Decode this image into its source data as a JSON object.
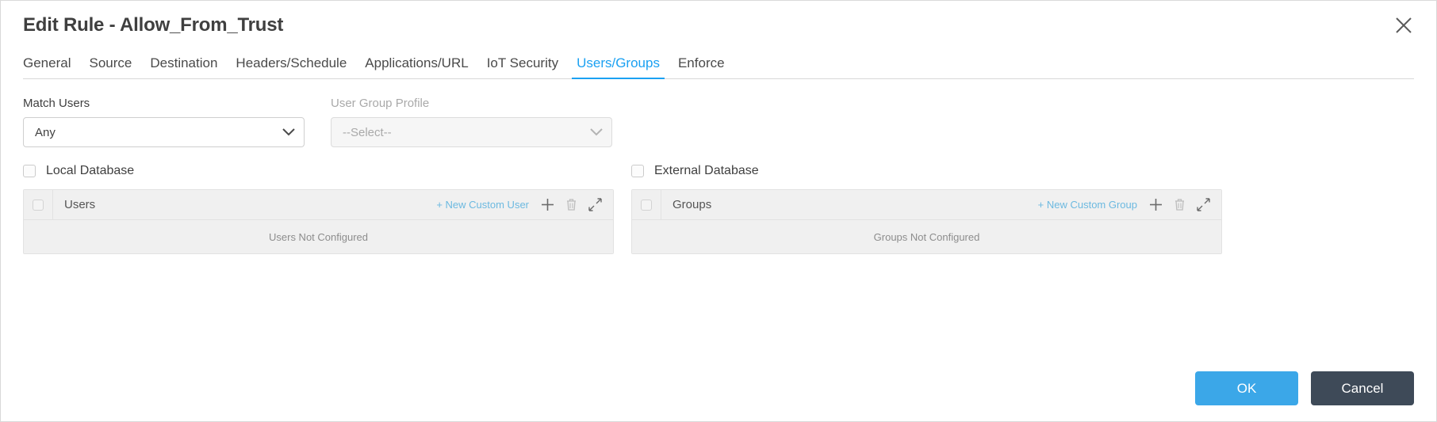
{
  "window": {
    "title": "Edit Rule - Allow_From_Trust",
    "close_icon": "close-icon"
  },
  "tabs": [
    {
      "label": "General",
      "active": false
    },
    {
      "label": "Source",
      "active": false
    },
    {
      "label": "Destination",
      "active": false
    },
    {
      "label": "Headers/Schedule",
      "active": false
    },
    {
      "label": "Applications/URL",
      "active": false
    },
    {
      "label": "IoT Security",
      "active": false
    },
    {
      "label": "Users/Groups",
      "active": true
    },
    {
      "label": "Enforce",
      "active": false
    }
  ],
  "form": {
    "match_users": {
      "label": "Match Users",
      "value": "Any",
      "disabled": false
    },
    "user_group_profile": {
      "label": "User Group Profile",
      "value": "--Select--",
      "disabled": true
    }
  },
  "panels": [
    {
      "checkbox_label": "Local Database",
      "checked": false,
      "table": {
        "column_header": "Users",
        "new_link": "+ New Custom User",
        "empty_message": "Users Not Configured",
        "icons": [
          "plus-icon",
          "trash-icon",
          "expand-icon"
        ]
      }
    },
    {
      "checkbox_label": "External Database",
      "checked": false,
      "table": {
        "column_header": "Groups",
        "new_link": "+ New Custom Group",
        "empty_message": "Groups Not Configured",
        "icons": [
          "plus-icon",
          "trash-icon",
          "expand-icon"
        ]
      }
    }
  ],
  "footer": {
    "ok_label": "OK",
    "cancel_label": "Cancel"
  },
  "colors": {
    "accent_blue": "#1ba1f2",
    "link_blue": "#6cb9e0",
    "ok_button": "#3ba7e8",
    "cancel_button": "#3e4a58"
  }
}
